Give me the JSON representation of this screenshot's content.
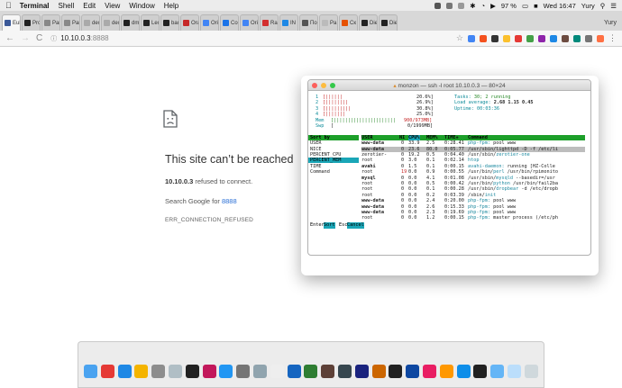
{
  "menubar": {
    "app": "Terminal",
    "items": [
      "Shell",
      "Edit",
      "View",
      "Window",
      "Help"
    ],
    "battery": "97 %",
    "clock": "Wed 16:47",
    "user": "Yury"
  },
  "tabs": [
    {
      "label": "Eul",
      "color": "#3b5998"
    },
    {
      "label": "Pro",
      "color": "#222222"
    },
    {
      "label": "Par",
      "color": "#888888"
    },
    {
      "label": "Par",
      "color": "#888888"
    },
    {
      "label": "dec",
      "color": "#aaaaaa"
    },
    {
      "label": "dec",
      "color": "#aaaaaa"
    },
    {
      "label": "dm",
      "color": "#222222"
    },
    {
      "label": "Lec",
      "color": "#222222"
    },
    {
      "label": "bac",
      "color": "#222222"
    },
    {
      "label": "Ora",
      "color": "#c62828"
    },
    {
      "label": "Ori",
      "color": "#4285f4"
    },
    {
      "label": "Co",
      "color": "#1a73e8"
    },
    {
      "label": "Ori",
      "color": "#4285f4"
    },
    {
      "label": "Ra",
      "color": "#d32f2f"
    },
    {
      "label": "IN",
      "color": "#1e88e5"
    },
    {
      "label": "По",
      "color": "#555555"
    },
    {
      "label": "Pa",
      "color": "#bbbbbb"
    },
    {
      "label": "Ск",
      "color": "#e65100"
    },
    {
      "label": "Die",
      "color": "#222222"
    },
    {
      "label": "Die",
      "color": "#222222"
    }
  ],
  "toolbar": {
    "back": "←",
    "forward": "→",
    "reload": "C",
    "url_host": "10.10.0.3",
    "url_port": ":8888"
  },
  "error": {
    "title": "This site can’t be reached",
    "host": "10.10.0.3",
    "refused": " refused to connect.",
    "search_prefix": "Search Google for ",
    "search_link": "8888",
    "code": "ERR_CONNECTION_REFUSED"
  },
  "terminal": {
    "title": "monzon — ssh -l root 10.10.0.3 — 80×24",
    "cpu": [
      {
        "num": "1",
        "bar": "[||||||",
        "pct": "20.6%]"
      },
      {
        "num": "2",
        "bar": "[||||||||",
        "pct": "26.9%]"
      },
      {
        "num": "3",
        "bar": "[|||||||||",
        "pct": "30.8%]"
      },
      {
        "num": "4",
        "bar": "[|||||||",
        "pct": "25.0%]"
      }
    ],
    "mem": {
      "label": "Mem",
      "bar": "[||||||||||||||||||||||",
      "value": "900/973MB]"
    },
    "swp": {
      "label": "Swp",
      "bar": "[",
      "value": "0/1999MB]"
    },
    "tasks_label": "Tasks: ",
    "tasks_value": "30; 2 running",
    "load_label": "Load average: ",
    "load_value": "2.68 1.15 0.45",
    "uptime_label": "Uptime: ",
    "uptime_value": "00:03:36",
    "sort_header": "Sort by",
    "sort_options": [
      "USER",
      "NICE",
      "PERCENT_CPU",
      "PERCENT_MEM",
      "TIME",
      "Command"
    ],
    "sort_selected": "PERCENT_MEM",
    "columns": {
      "user": "USER",
      "ni": "NI",
      "cpu": "CPU%",
      "mem": "MEM%",
      "time": "TIME+",
      "cmd": "Command"
    },
    "rows": [
      {
        "user": "www-data",
        "ni": "0",
        "cpu": "33.9",
        "mem": "2.5",
        "time": "0:28.41",
        "cmd_hl": "php-fpm:",
        "cmd": " pool www"
      },
      {
        "user": "www-data",
        "ni": "0",
        "cpu": "23.6",
        "mem": "80.0",
        "time": "0:05.77",
        "cmd_hl": "",
        "cmd": "/usr/sbin/lighttpd -D -f /etc/li"
      },
      {
        "user": "zerotier-",
        "ni": "0",
        "cpu": "19.2",
        "mem": "0.5",
        "time": "0:04.40",
        "cmd_hl": "",
        "cmd": "/usr/sbin/",
        "cmd_tail": "zerotier-one"
      },
      {
        "user": "root",
        "ni": "0",
        "cpu": "3.0",
        "mem": "0.1",
        "time": "0:02.14",
        "cmd_hl": "htop",
        "cmd": ""
      },
      {
        "user": "avahi",
        "ni": "0",
        "cpu": "1.5",
        "mem": "0.1",
        "time": "0:00.15",
        "cmd_hl": "avahi-daemon:",
        "cmd": " running [HZ-Colle"
      },
      {
        "user": "root",
        "ni": "19",
        "cpu": "0.0",
        "mem": "0.9",
        "time": "0:00.55",
        "cmd_hl": "",
        "cmd": "/usr/bin/",
        "cmd_tail": "perl",
        "cmd_rest": " /usr/bin/rpimonito"
      },
      {
        "user": "mysql",
        "ni": "0",
        "cpu": "0.0",
        "mem": "4.1",
        "time": "0:01.08",
        "cmd_hl": "",
        "cmd": "/usr/sbin/",
        "cmd_tail": "mysqld",
        "cmd_rest": " --basedir=/usr"
      },
      {
        "user": "root",
        "ni": "0",
        "cpu": "0.0",
        "mem": "0.5",
        "time": "0:00.42",
        "cmd_hl": "",
        "cmd": "/usr/bin/",
        "cmd_tail": "python",
        "cmd_rest": " /usr/bin/fail2ba"
      },
      {
        "user": "root",
        "ni": "0",
        "cpu": "0.0",
        "mem": "0.1",
        "time": "0:00.28",
        "cmd_hl": "",
        "cmd": "/usr/sbin/",
        "cmd_tail": "dropbear",
        "cmd_rest": " -d /etc/dropb"
      },
      {
        "user": "root",
        "ni": "0",
        "cpu": "0.0",
        "mem": "0.2",
        "time": "0:03.39",
        "cmd_hl": "",
        "cmd": "/sbin/",
        "cmd_tail": "init"
      },
      {
        "user": "www-data",
        "ni": "0",
        "cpu": "0.0",
        "mem": "2.4",
        "time": "0:20.00",
        "cmd_hl": "php-fpm:",
        "cmd": " pool www"
      },
      {
        "user": "www-data",
        "ni": "0",
        "cpu": "0.0",
        "mem": "2.6",
        "time": "0:15.33",
        "cmd_hl": "php-fpm:",
        "cmd": " pool www"
      },
      {
        "user": "www-data",
        "ni": "0",
        "cpu": "0.0",
        "mem": "2.3",
        "time": "0:19.69",
        "cmd_hl": "php-fpm:",
        "cmd": " pool www"
      },
      {
        "user": "root",
        "ni": "0",
        "cpu": "0.0",
        "mem": "1.2",
        "time": "0:00.15",
        "cmd_hl": "php-fpm:",
        "cmd": " master process (/etc/ph"
      }
    ],
    "footer": {
      "k1": "Enter",
      "l1": "Sort",
      "k2": "Esc",
      "l2": "Cancel"
    }
  },
  "dock": [
    {
      "name": "finder-icon",
      "color": "#4aa3f0"
    },
    {
      "name": "chrome-icon",
      "color": "#e53935"
    },
    {
      "name": "safari-icon",
      "color": "#1e88e5"
    },
    {
      "name": "photos-icon",
      "color": "#f4b400"
    },
    {
      "name": "tools-icon",
      "color": "#8d8d8d"
    },
    {
      "name": "launch-icon",
      "color": "#b0bec5"
    },
    {
      "name": "piano-icon",
      "color": "#212121"
    },
    {
      "name": "music-icon",
      "color": "#c2185b"
    },
    {
      "name": "appstore-icon",
      "color": "#2196f3"
    },
    {
      "name": "settings-icon",
      "color": "#757575"
    },
    {
      "name": "preview-icon",
      "color": "#90a4ae"
    },
    {
      "name": "textedit-icon",
      "color": "#eeeeee"
    },
    {
      "name": "word-icon",
      "color": "#1565c0"
    },
    {
      "name": "excel-icon",
      "color": "#2e7d32"
    },
    {
      "name": "photo-icon",
      "color": "#5d4037"
    },
    {
      "name": "camera-icon",
      "color": "#37474f"
    },
    {
      "name": "virtualbox-icon",
      "color": "#1a237e"
    },
    {
      "name": "app-icon",
      "color": "#cc6600"
    },
    {
      "name": "live-icon",
      "color": "#212121"
    },
    {
      "name": "xcode-icon",
      "color": "#0d47a1"
    },
    {
      "name": "flower-icon",
      "color": "#e91e63"
    },
    {
      "name": "vlc-icon",
      "color": "#ff9800"
    },
    {
      "name": "teamviewer-icon",
      "color": "#0e8ee9"
    },
    {
      "name": "terminal-icon",
      "color": "#212121"
    },
    {
      "name": "folder-icon",
      "color": "#64b5f6"
    },
    {
      "name": "files-icon",
      "color": "#bbdefb"
    },
    {
      "name": "trash-icon",
      "color": "#cfd8dc"
    }
  ]
}
